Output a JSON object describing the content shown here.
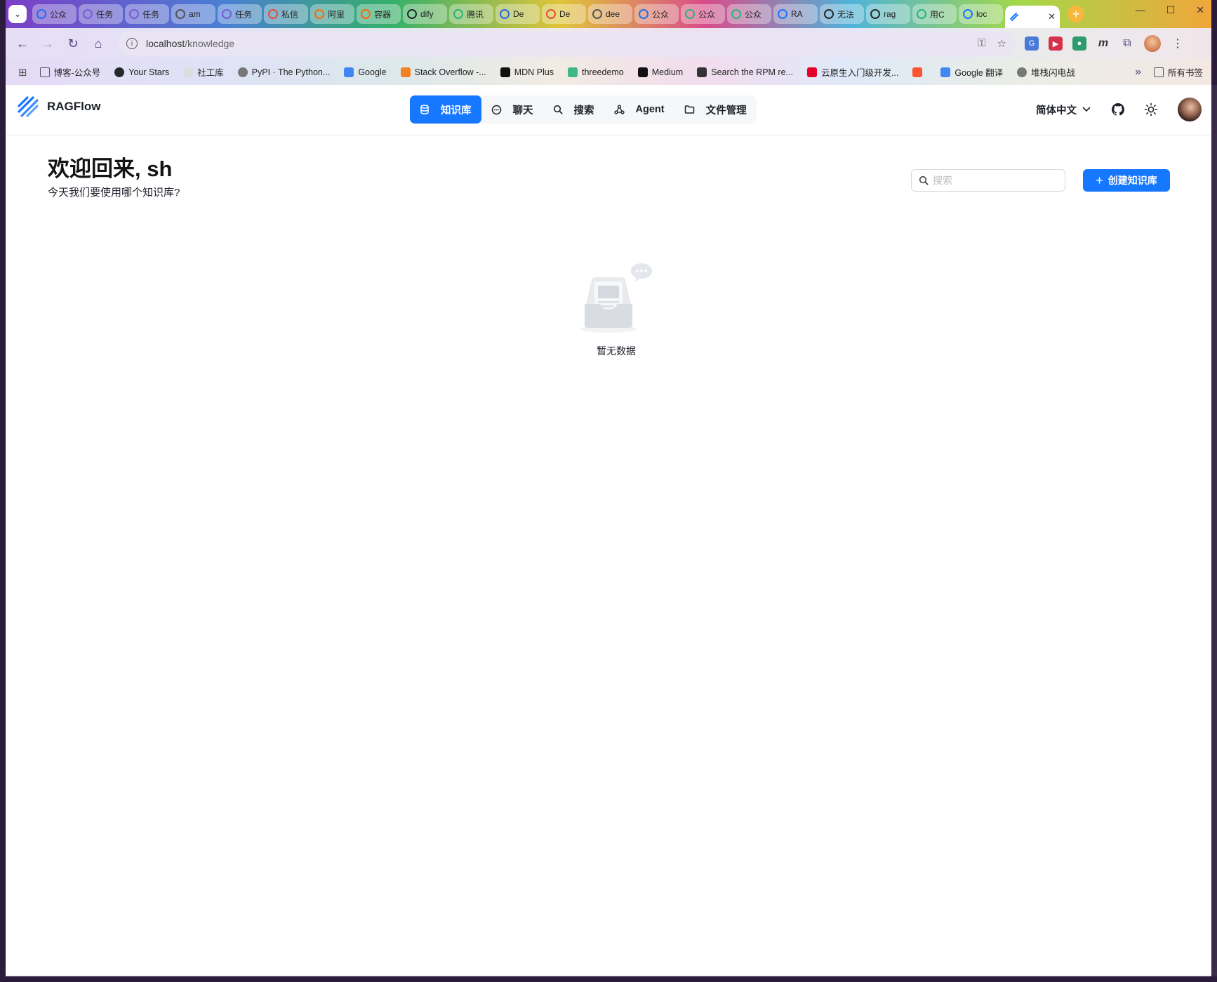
{
  "browser": {
    "tabs": [
      {
        "label": "公众",
        "color": "#1a73e8"
      },
      {
        "label": "任务",
        "color": "#7a5bd6"
      },
      {
        "label": "任务",
        "color": "#7a5bd6"
      },
      {
        "label": "am",
        "color": "#555555"
      },
      {
        "label": "任务",
        "color": "#7a5bd6"
      },
      {
        "label": "私信",
        "color": "#e94b35"
      },
      {
        "label": "阿里",
        "color": "#ff6a00"
      },
      {
        "label": "容器",
        "color": "#ff6a00"
      },
      {
        "label": "dify",
        "color": "#24292e"
      },
      {
        "label": "腾讯",
        "color": "#2ab37a"
      },
      {
        "label": "De",
        "color": "#2c64f6"
      },
      {
        "label": "De",
        "color": "#e94b35"
      },
      {
        "label": "dee",
        "color": "#555555"
      },
      {
        "label": "公众",
        "color": "#1a73e8"
      },
      {
        "label": "公众",
        "color": "#2ab37a"
      },
      {
        "label": "公众",
        "color": "#2ab37a"
      },
      {
        "label": "RA",
        "color": "#1677ff"
      },
      {
        "label": "无法",
        "color": "#24292e"
      },
      {
        "label": "rag",
        "color": "#24292e"
      },
      {
        "label": "用C",
        "color": "#2ab37a"
      },
      {
        "label": "loc",
        "color": "#1677ff"
      }
    ],
    "active_tab": {
      "label": "",
      "close": "✕"
    },
    "url_host": "localhost",
    "url_path": "/knowledge",
    "bookmarks": [
      {
        "label": "博客-公众号",
        "icon": "folder-icon",
        "color": "#555555"
      },
      {
        "label": "Your Stars",
        "icon": "github-icon",
        "color": "#24292e"
      },
      {
        "label": "社工库",
        "icon": "page-icon",
        "color": "#dddddd"
      },
      {
        "label": "PyPI · The Python...",
        "icon": "globe-icon",
        "color": "#777777"
      },
      {
        "label": "Google",
        "icon": "google-icon",
        "color": "#4285f4"
      },
      {
        "label": "Stack Overflow -...",
        "icon": "stackoverflow-icon",
        "color": "#f48024"
      },
      {
        "label": "MDN Plus",
        "icon": "mdn-icon",
        "color": "#111111"
      },
      {
        "label": "threedemo",
        "icon": "vue-icon",
        "color": "#41b883"
      },
      {
        "label": "Medium",
        "icon": "medium-icon",
        "color": "#111111"
      },
      {
        "label": "Search the RPM re...",
        "icon": "linux-icon",
        "color": "#333333"
      },
      {
        "label": "云原生入门级开发...",
        "icon": "huawei-icon",
        "color": "#e4002b"
      },
      {
        "label": "",
        "icon": "csdn-icon",
        "color": "#fc5531"
      },
      {
        "label": "Google 翻译",
        "icon": "translate-icon",
        "color": "#4285f4"
      },
      {
        "label": "堆栈闪电战",
        "icon": "globe-icon",
        "color": "#777777"
      }
    ],
    "bookmarks_more": "»",
    "all_bookmarks": "所有书签"
  },
  "app": {
    "brand": "RAGFlow",
    "accent": "#1677ff",
    "nav": [
      {
        "label": "知识库",
        "icon": "database-icon",
        "active": true
      },
      {
        "label": "聊天",
        "icon": "chat-icon",
        "active": false
      },
      {
        "label": "搜索",
        "icon": "search-icon",
        "active": false
      },
      {
        "label": "Agent",
        "icon": "agent-icon",
        "active": false
      },
      {
        "label": "文件管理",
        "icon": "folder-icon",
        "active": false
      }
    ],
    "language": "简体中文",
    "welcome_title": "欢迎回来, sh",
    "welcome_subtitle": "今天我们要使用哪个知识库?",
    "search_placeholder": "搜索",
    "create_button": "创建知识库",
    "empty_text": "暂无数据"
  }
}
